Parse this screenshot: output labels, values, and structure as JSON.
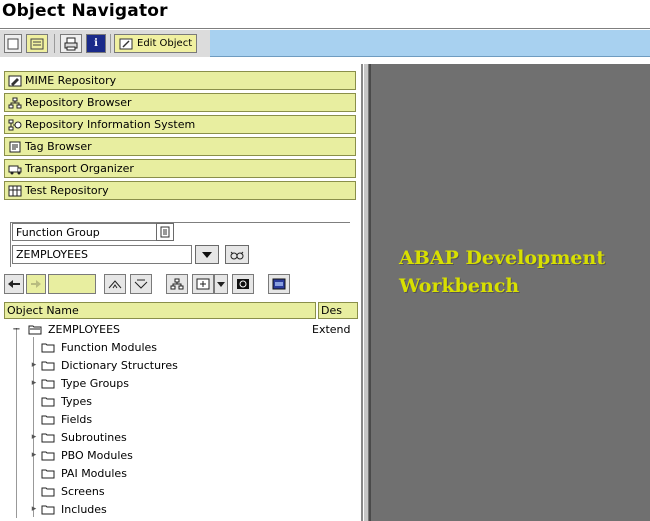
{
  "window": {
    "title": "Object Navigator"
  },
  "toolbar": {
    "edit_object_label": "Edit Object"
  },
  "navigation": [
    {
      "label": "MIME Repository",
      "icon": "mime-icon"
    },
    {
      "label": "Repository Browser",
      "icon": "hierarchy-icon"
    },
    {
      "label": "Repository Information System",
      "icon": "info-system-icon"
    },
    {
      "label": "Tag Browser",
      "icon": "tag-icon"
    },
    {
      "label": "Transport Organizer",
      "icon": "transport-icon"
    },
    {
      "label": "Test Repository",
      "icon": "test-icon"
    }
  ],
  "object_selector": {
    "type_value": "Function Group",
    "name_value": "ZEMPLOYEES"
  },
  "tree": {
    "columns": {
      "name": "Object Name",
      "desc": "Des"
    },
    "root": {
      "label": "ZEMPLOYEES",
      "desc": "Extend"
    },
    "children": [
      {
        "label": "Function Modules"
      },
      {
        "label": "Dictionary Structures"
      },
      {
        "label": "Type Groups"
      },
      {
        "label": "Types"
      },
      {
        "label": "Fields"
      },
      {
        "label": "Subroutines"
      },
      {
        "label": "PBO Modules"
      },
      {
        "label": "PAI Modules"
      },
      {
        "label": "Screens"
      },
      {
        "label": "Includes"
      }
    ]
  },
  "workbench": {
    "line1": "ABAP Development",
    "line2": "Workbench"
  },
  "colors": {
    "nav_yellow": "#e8eea0",
    "workbench_text": "#d8e000",
    "toolbar_blue": "#a8d1f0"
  }
}
